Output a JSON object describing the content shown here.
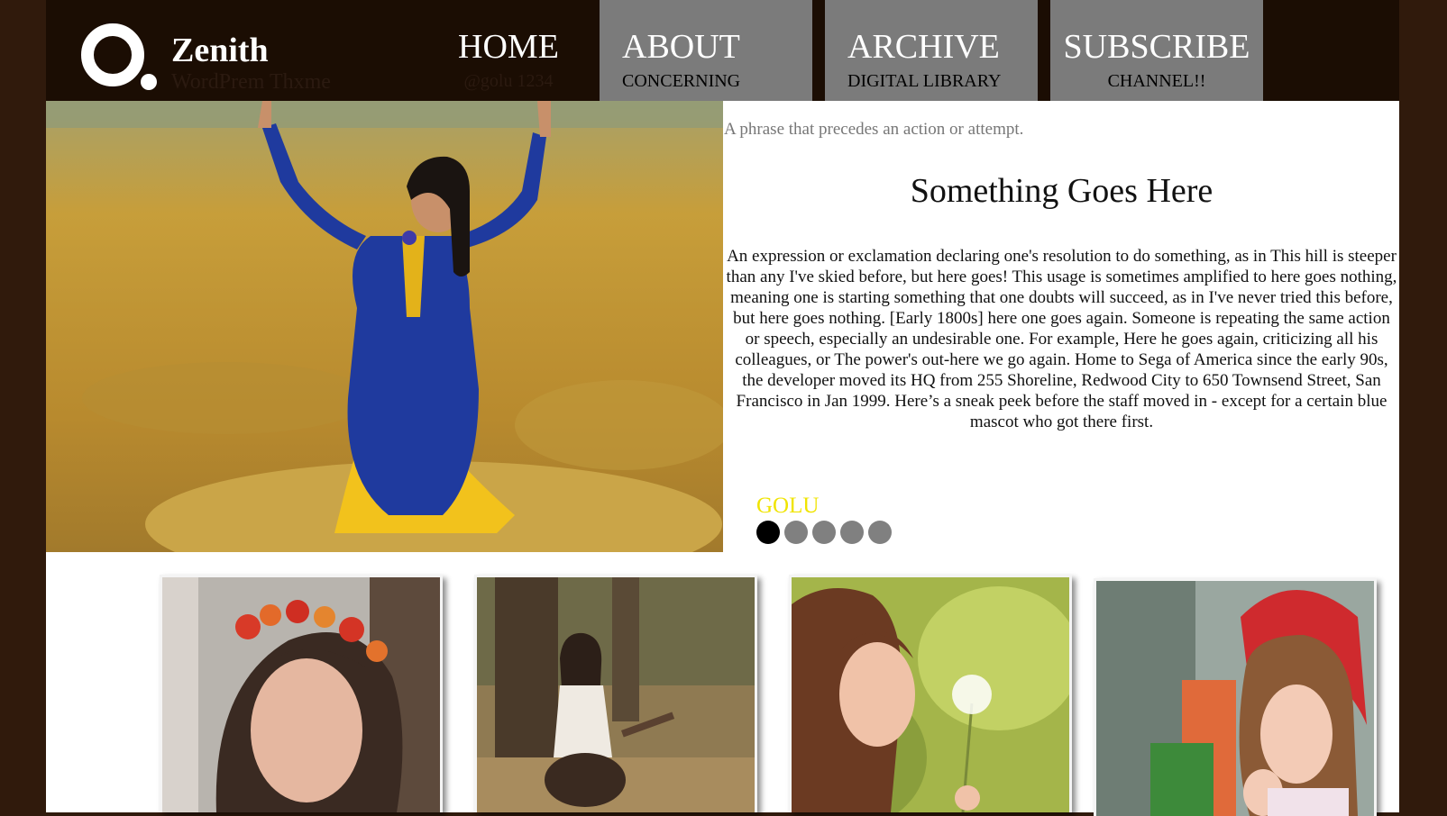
{
  "header": {
    "site_name": "Zenith",
    "tagline": "WordPrem Thxme"
  },
  "nav": {
    "items": [
      {
        "title": "HOME",
        "subtitle": "@golu 1234"
      },
      {
        "title": "ABOUT",
        "subtitle": "CONCERNING"
      },
      {
        "title": "ARCHIVE",
        "subtitle": "DIGITAL LIBRARY"
      },
      {
        "title": "SUBSCRIBE",
        "subtitle": "CHANNEL!!"
      }
    ]
  },
  "hero": {
    "image": "girl-in-blue-dress-wheat-field-photo"
  },
  "content": {
    "intro": "A phrase that precedes an action or attempt.",
    "headline": "Something Goes Here",
    "body": "An expression or exclamation declaring one's resolution to do something, as in This hill is steeper than any I've skied before, but here goes! This usage is sometimes amplified to here goes nothing, meaning one is starting something that one doubts will succeed, as in I've never tried this before, but here goes nothing. [Early 1800s] here one goes again. Someone is repeating the same action or speech, especially an undesirable one. For example, Here he goes again, criticizing all his colleagues, or The power's out-here we go again. Home to Sega of America since the early 90s, the developer moved its HQ from 255 Shoreline, Redwood City to 650 Townsend Street, San Francisco in Jan 1999. Here’s a sneak peek before the staff moved in - except for a certain blue mascot who got there first."
  },
  "slider": {
    "label": "GOLU",
    "dot_count": 5,
    "active_index": 0,
    "label_color": "#f0e400"
  },
  "gallery": {
    "items": [
      {
        "image": "girl-with-flower-crown-photo"
      },
      {
        "image": "girl-with-guitar-in-forest-photo"
      },
      {
        "image": "girl-blowing-dandelion-photo"
      },
      {
        "image": "girl-in-red-beret-photo"
      }
    ]
  },
  "colors": {
    "background": "#301a0c",
    "header": "#1b0d03",
    "nav_box": "#7b7b7b"
  }
}
